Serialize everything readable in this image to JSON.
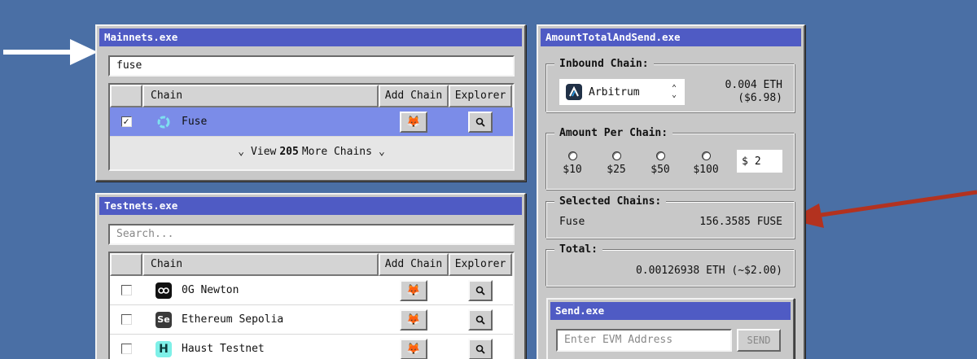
{
  "mainnets": {
    "title": "Mainnets.exe",
    "search_value": "fuse",
    "headers": {
      "chain": "Chain",
      "add_chain": "Add Chain",
      "explorer": "Explorer"
    },
    "rows": [
      {
        "name": "Fuse",
        "checked": "✓",
        "icon": "fuse-logo-icon"
      }
    ],
    "more": {
      "prefix": "View",
      "count": "205",
      "suffix": "More Chains"
    }
  },
  "testnets": {
    "title": "Testnets.exe",
    "search_placeholder": "Search...",
    "headers": {
      "chain": "Chain",
      "add_chain": "Add Chain",
      "explorer": "Explorer"
    },
    "rows": [
      {
        "name": "0G Newton",
        "icon": "0g-logo-icon"
      },
      {
        "name": "Ethereum Sepolia",
        "icon_text": "Se",
        "icon": "sepolia-logo-icon"
      },
      {
        "name": "Haust Testnet",
        "icon_text": "H",
        "icon": "haust-logo-icon"
      }
    ]
  },
  "amount": {
    "title": "AmountTotalAndSend.exe",
    "inbound": {
      "label": "Inbound Chain:",
      "selected_chain": "Arbitrum",
      "eth": "0.004 ETH",
      "usd": "($6.98)"
    },
    "per_chain": {
      "label": "Amount Per Chain:",
      "options": [
        "$10",
        "$25",
        "$50",
        "$100"
      ],
      "currency": "$",
      "custom_value": "2"
    },
    "selected": {
      "label": "Selected Chains:",
      "chain": "Fuse",
      "value": "156.3585 FUSE"
    },
    "total": {
      "label": "Total:",
      "value": "0.00126938 ETH (~$2.00)"
    }
  },
  "send": {
    "title": "Send.exe",
    "address_placeholder": "Enter EVM Address",
    "button": "SEND"
  },
  "colors": {
    "background": "#4a6fa5",
    "titlebar": "#4f5bc4",
    "selected_row": "#7b8ce8",
    "white_arrow": "#ffffff",
    "red_arrow": "#b3321f"
  }
}
